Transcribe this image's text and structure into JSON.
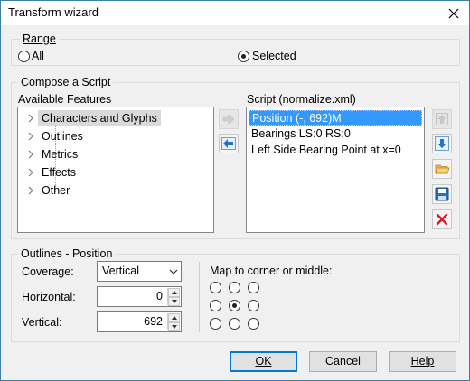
{
  "window": {
    "title": "Transform wizard"
  },
  "range": {
    "label": "Range",
    "options": [
      {
        "label": "All",
        "selected": false
      },
      {
        "label": "Selected",
        "selected": true
      }
    ]
  },
  "compose": {
    "label": "Compose a Script",
    "available_label": "Available Features",
    "features": [
      {
        "label": "Characters and Glyphs",
        "selected": true
      },
      {
        "label": "Outlines",
        "selected": false
      },
      {
        "label": "Metrics",
        "selected": false
      },
      {
        "label": "Effects",
        "selected": false
      },
      {
        "label": "Other",
        "selected": false
      }
    ],
    "script_label": "Script (normalize.xml)",
    "script_items": [
      {
        "label": "Position (-, 692)M",
        "selected": true
      },
      {
        "label": "Bearings LS:0 RS:0",
        "selected": false
      },
      {
        "label": "Left Side Bearing Point at x=0",
        "selected": false
      }
    ]
  },
  "outlines_position": {
    "label": "Outlines - Position",
    "coverage_label": "Coverage:",
    "coverage_value": "Vertical",
    "horizontal_label": "Horizontal:",
    "horizontal_value": "0",
    "vertical_label": "Vertical:",
    "vertical_value": "692",
    "map_label": "Map to corner or middle:",
    "grid_selected": [
      1,
      1
    ]
  },
  "buttons": {
    "ok": "OK",
    "cancel": "Cancel",
    "help": "Help"
  },
  "colors": {
    "selection": "#3399ff",
    "delete": "#e81123",
    "nav_arrow": "#1e73d2"
  }
}
